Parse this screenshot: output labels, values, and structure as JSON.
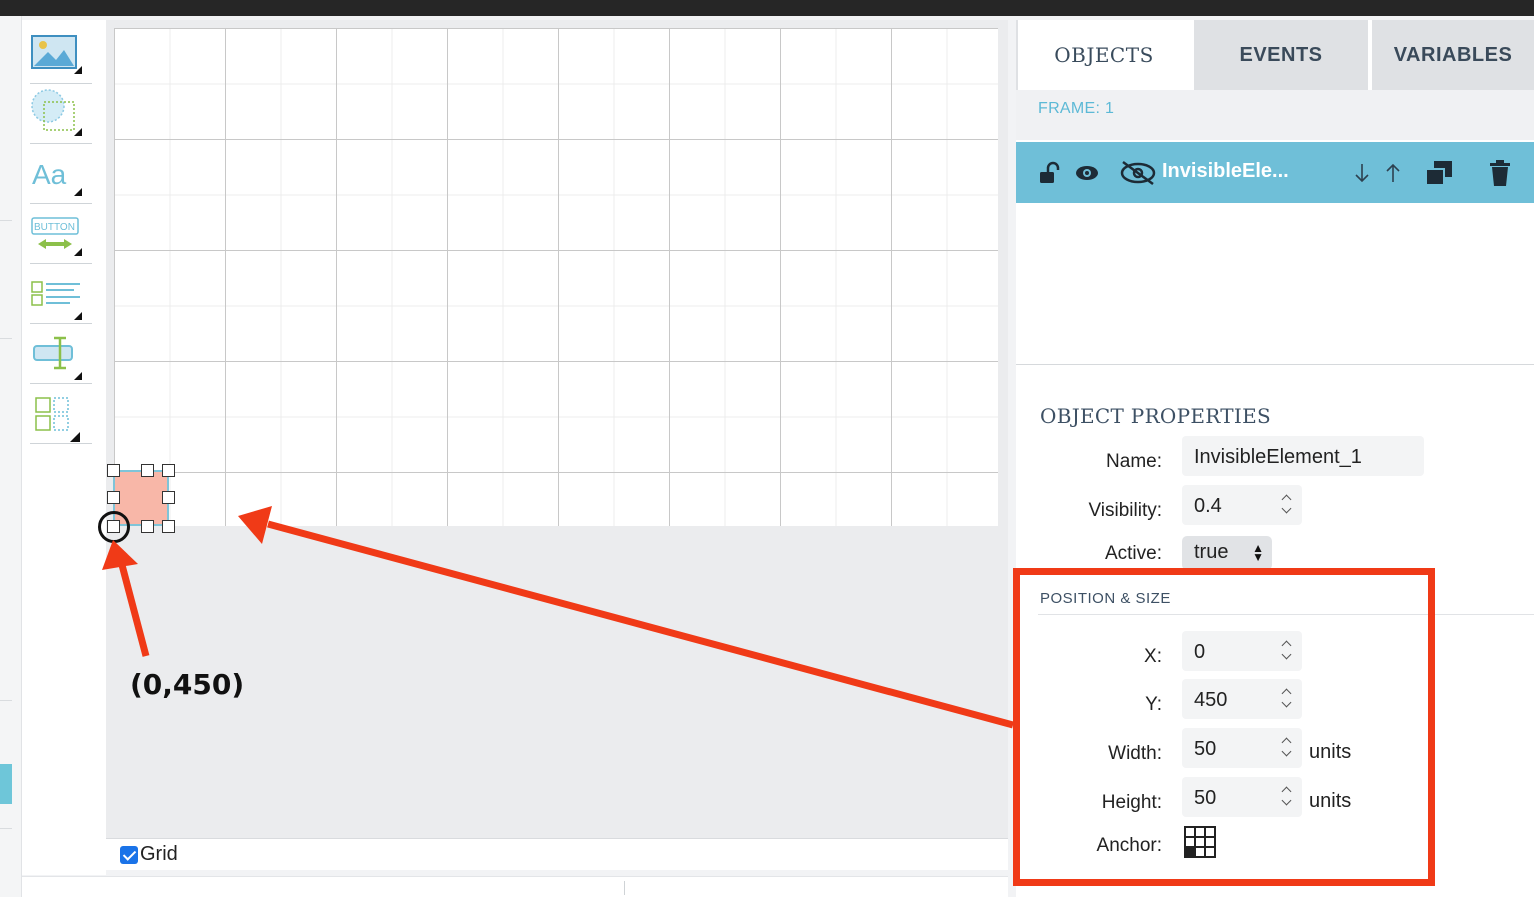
{
  "tabs": {
    "objects": "OBJECTS",
    "events": "EVENTS",
    "variables": "VARIABLES"
  },
  "frame_label": "FRAME: 1",
  "object_row": {
    "name": "InvisibleEle..."
  },
  "object_properties": {
    "title": "OBJECT PROPERTIES",
    "name_label": "Name:",
    "name_value": "InvisibleElement_1",
    "visibility_label": "Visibility:",
    "visibility_value": "0.4",
    "active_label": "Active:",
    "active_value": "true"
  },
  "position_size": {
    "title": "POSITION & SIZE",
    "x_label": "X:",
    "x_value": "0",
    "y_label": "Y:",
    "y_value": "450",
    "width_label": "Width:",
    "width_value": "50",
    "height_label": "Height:",
    "height_value": "50",
    "units": "units",
    "anchor_label": "Anchor:"
  },
  "canvas": {
    "grid_label": "Grid",
    "grid_checked": true,
    "annotation": "(0,450)"
  },
  "toolbar_tools": [
    "image-tool",
    "shape-tool",
    "text-tool",
    "button-tool",
    "list-tool",
    "input-tool",
    "group-tool"
  ],
  "colors": {
    "accent": "#6fbfd8",
    "highlight": "#f03a17",
    "element_fill": "#f8b7a8"
  }
}
